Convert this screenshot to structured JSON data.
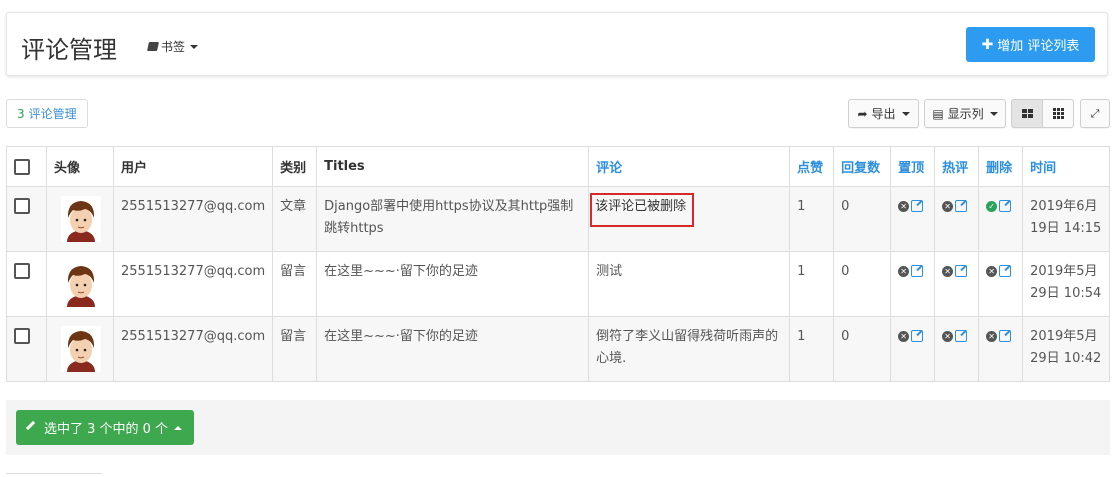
{
  "header": {
    "title": "评论管理",
    "bookmark_label": "书签",
    "add_button_label": "增加 评论列表"
  },
  "summary": {
    "count": "3",
    "label": "评论管理"
  },
  "toolbar": {
    "export_label": "导出",
    "columns_label": "显示列"
  },
  "table": {
    "headers": [
      "头像",
      "用户",
      "类别",
      "Titles",
      "评论",
      "点赞",
      "回复数",
      "置顶",
      "热评",
      "删除",
      "时间"
    ],
    "rows": [
      {
        "user": "2551513277@qq.com",
        "category": "文章",
        "title": "Django部署中使用https协议及其http强制跳转https",
        "comment": "该评论已被删除",
        "likes": "1",
        "replies": "0",
        "time": "2019年6月19日 14:15",
        "top": "false",
        "hot": "false",
        "deleted": "true"
      },
      {
        "user": "2551513277@qq.com",
        "category": "留言",
        "title": "在这里~~~·留下你的足迹",
        "comment": "测试",
        "likes": "1",
        "replies": "0",
        "time": "2019年5月29日 10:54",
        "top": "false",
        "hot": "false",
        "deleted": "false"
      },
      {
        "user": "2551513277@qq.com",
        "category": "留言",
        "title": "在这里~~~·留下你的足迹",
        "comment": "倒符了李义山留得残荷听雨声的心境.",
        "likes": "1",
        "replies": "0",
        "time": "2019年5月29日 10:42",
        "top": "false",
        "hot": "false",
        "deleted": "false"
      }
    ]
  },
  "footer": {
    "action_label": "选中了 3 个中的 0 个"
  },
  "colors": {
    "primary": "#2d9cf0",
    "success": "#3ea84e",
    "highlight_border": "#d62a2a",
    "link": "#2d8fe0"
  }
}
